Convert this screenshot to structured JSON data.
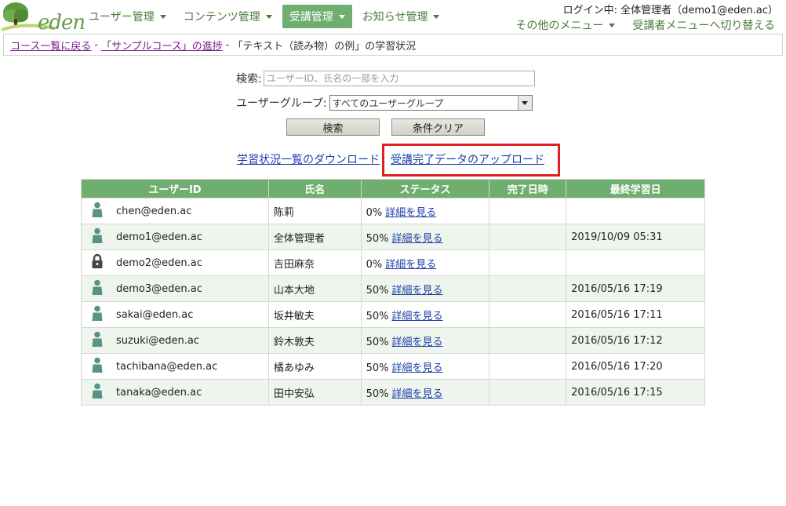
{
  "header": {
    "logo_text": "eden",
    "nav": [
      {
        "label": "ユーザー管理",
        "active": false
      },
      {
        "label": "コンテンツ管理",
        "active": false
      },
      {
        "label": "受講管理",
        "active": true
      },
      {
        "label": "お知らせ管理",
        "active": false
      }
    ],
    "login_info": "ログイン中: 全体管理者（demo1@eden.ac）",
    "other_menu": "その他のメニュー",
    "switch_menu": "受講者メニューへ切り替える"
  },
  "breadcrumb": {
    "back_link": "コース一覧に戻る",
    "progress_link": "「サンプルコース」の進捗",
    "current": "「テキスト（読み物）の例」の学習状況",
    "separator": "-"
  },
  "search": {
    "label": "検索:",
    "placeholder": "ユーザーID、氏名の一部を入力",
    "group_label": "ユーザーグループ:",
    "group_selected": "すべてのユーザーグループ",
    "search_button": "検索",
    "clear_button": "条件クリア"
  },
  "links": {
    "download": "学習状況一覧のダウンロード",
    "upload": "受講完了データのアップロード"
  },
  "table": {
    "headers": [
      "ユーザーID",
      "氏名",
      "ステータス",
      "完了日時",
      "最終学習日"
    ],
    "detail_label": "詳細を見る",
    "rows": [
      {
        "user_id": "chen@eden.ac",
        "name": "陈莉",
        "status": "0%",
        "completed": "",
        "last_study": "",
        "icon": "person-icon"
      },
      {
        "user_id": "demo1@eden.ac",
        "name": "全体管理者",
        "status": "50%",
        "completed": "",
        "last_study": "2019/10/09 05:31",
        "icon": "person-icon"
      },
      {
        "user_id": "demo2@eden.ac",
        "name": "吉田麻奈",
        "status": "0%",
        "completed": "",
        "last_study": "",
        "icon": "lock-icon"
      },
      {
        "user_id": "demo3@eden.ac",
        "name": "山本大地",
        "status": "50%",
        "completed": "",
        "last_study": "2016/05/16 17:19",
        "icon": "person-icon"
      },
      {
        "user_id": "sakai@eden.ac",
        "name": "坂井敏夫",
        "status": "50%",
        "completed": "",
        "last_study": "2016/05/16 17:11",
        "icon": "person-icon"
      },
      {
        "user_id": "suzuki@eden.ac",
        "name": "鈴木敦夫",
        "status": "50%",
        "completed": "",
        "last_study": "2016/05/16 17:12",
        "icon": "person-icon"
      },
      {
        "user_id": "tachibana@eden.ac",
        "name": "橘あゆみ",
        "status": "50%",
        "completed": "",
        "last_study": "2016/05/16 17:20",
        "icon": "person-icon"
      },
      {
        "user_id": "tanaka@eden.ac",
        "name": "田中安弘",
        "status": "50%",
        "completed": "",
        "last_study": "2016/05/16 17:15",
        "icon": "person-icon"
      }
    ]
  },
  "colors": {
    "accent": "#6fae6e",
    "link": "#1a3fa8",
    "highlight": "#e02020"
  }
}
